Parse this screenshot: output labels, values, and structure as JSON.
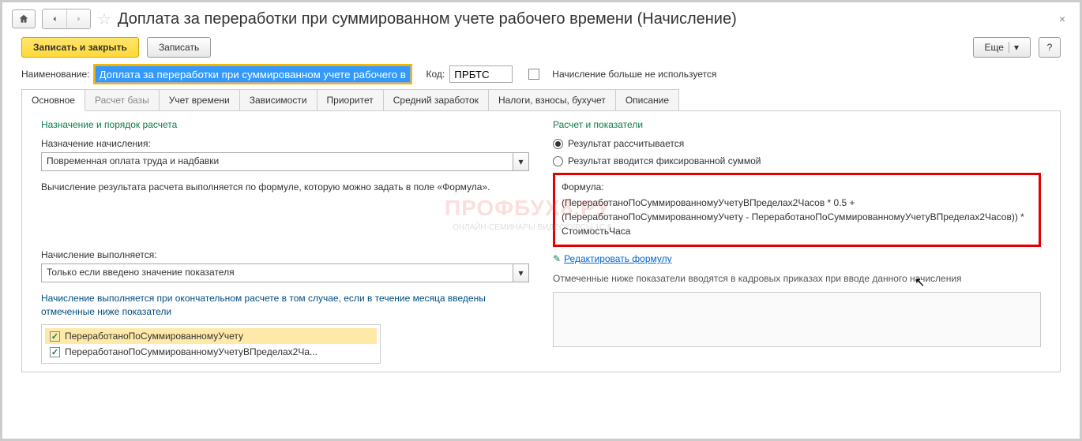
{
  "titlebar": {
    "title": "Доплата за переработки при суммированном учете рабочего времени (Начисление)"
  },
  "toolbar": {
    "save_close": "Записать и закрыть",
    "save": "Записать",
    "more": "Еще",
    "help": "?"
  },
  "header": {
    "name_label": "Наименование:",
    "name_value": "Доплата за переработки при суммированном учете рабочего врем",
    "code_label": "Код:",
    "code_value": "ПРБТС",
    "not_used_label": "Начисление больше не используется"
  },
  "tabs": [
    {
      "label": "Основное",
      "active": true
    },
    {
      "label": "Расчет базы",
      "disabled": true
    },
    {
      "label": "Учет времени"
    },
    {
      "label": "Зависимости"
    },
    {
      "label": "Приоритет"
    },
    {
      "label": "Средний заработок"
    },
    {
      "label": "Налоги, взносы, бухучет"
    },
    {
      "label": "Описание"
    }
  ],
  "left": {
    "section": "Назначение и порядок расчета",
    "purpose_label": "Назначение начисления:",
    "purpose_value": "Повременная оплата труда и надбавки",
    "description": "Вычисление результата расчета выполняется по формуле, которую можно задать в поле «Формула».",
    "exec_label": "Начисление выполняется:",
    "exec_value": "Только если введено значение показателя",
    "exec_note": "Начисление выполняется при окончательном расчете в том случае, если в течение месяца введены отмеченные ниже показатели",
    "indicators": [
      {
        "label": "ПереработаноПоСуммированномуУчету",
        "checked": true,
        "selected": true
      },
      {
        "label": "ПереработаноПоСуммированномуУчетуВПределах2Ча...",
        "checked": true
      }
    ]
  },
  "right": {
    "section": "Расчет и показатели",
    "radio1": "Результат рассчитывается",
    "radio2": "Результат вводится фиксированной суммой",
    "formula_label": "Формула:",
    "formula_text": "(ПереработаноПоСуммированномуУчетуВПределах2Часов * 0.5 + (ПереработаноПоСуммированномуУчету - ПереработаноПоСуммированномуУчетуВПределах2Часов)) * СтоимостьЧаса",
    "edit_link": "Редактировать формулу",
    "note": "Отмеченные ниже показатели вводятся в кадровых приказах при вводе данного начисления"
  },
  "watermark": {
    "main": "ПРОФБУХ8.РУ",
    "sub": "ОНЛАЙН-СЕМИНАРЫ  ВИДЕОКУРСЫ 1С:8"
  }
}
